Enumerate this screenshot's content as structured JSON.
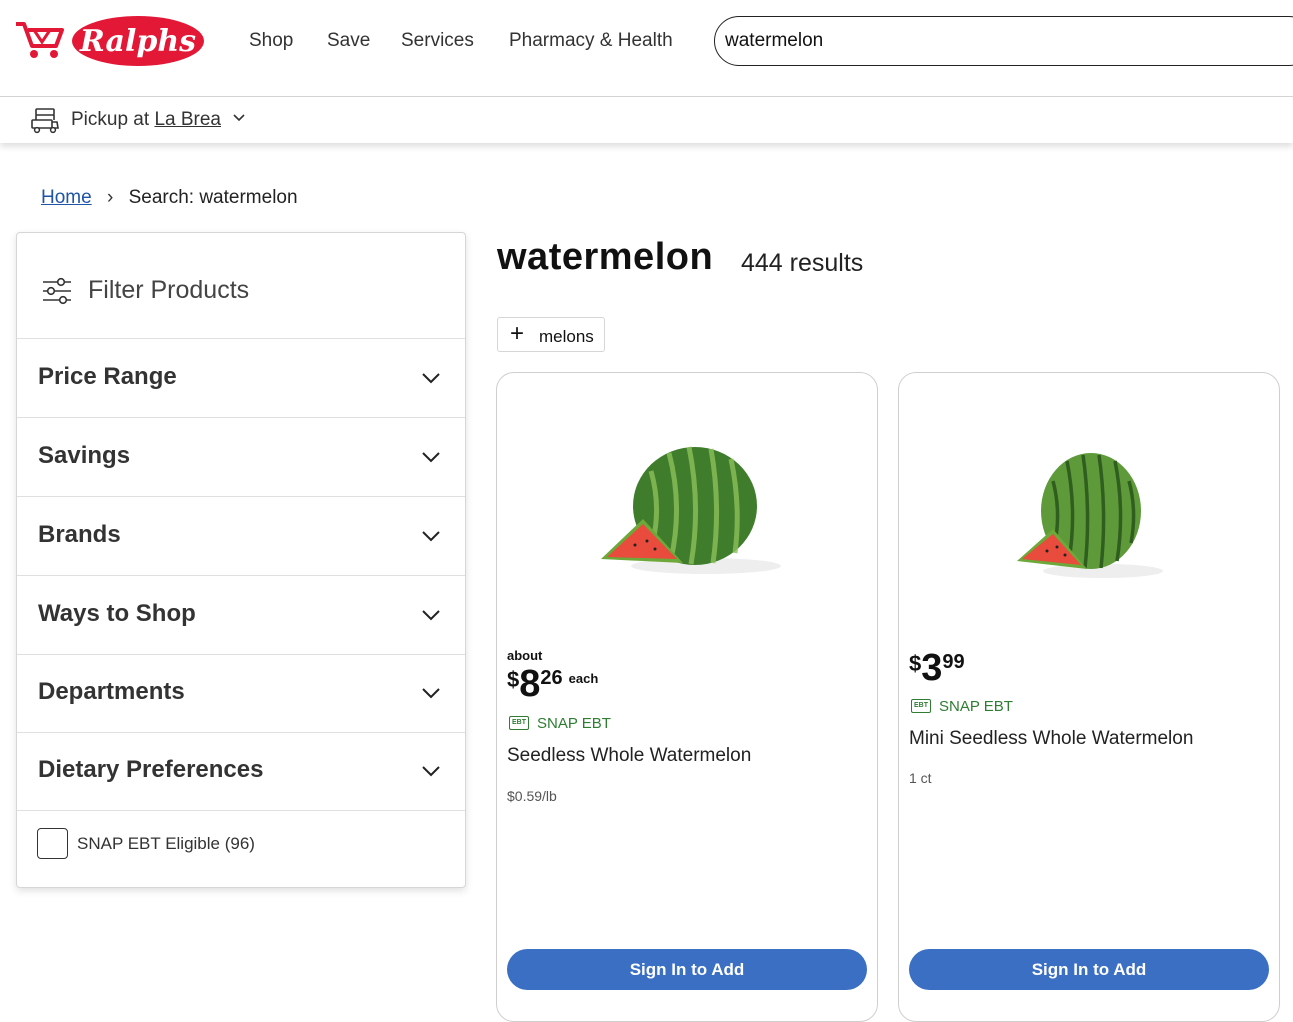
{
  "brand": {
    "logo_text": "Ralphs",
    "primary_color": "#e31837",
    "accent_color": "#3a6fc4"
  },
  "nav": {
    "items": [
      "Shop",
      "Save",
      "Services",
      "Pharmacy & Health"
    ]
  },
  "search": {
    "value": "watermelon"
  },
  "pickup": {
    "prefix": "Pickup at",
    "location": "La Brea"
  },
  "breadcrumb": {
    "home": "Home",
    "separator": "›",
    "current": "Search: watermelon"
  },
  "filters": {
    "title": "Filter Products",
    "facets": [
      "Price Range",
      "Savings",
      "Brands",
      "Ways to Shop",
      "Departments",
      "Dietary Preferences"
    ],
    "snap_checkbox": {
      "label": "SNAP EBT Eligible (96)",
      "checked": false
    }
  },
  "results": {
    "query": "watermelon",
    "count": "444 results",
    "chip": "melons"
  },
  "products": [
    {
      "about": "about",
      "currency": "$",
      "dollars": "8",
      "cents": "26",
      "unit": "each",
      "snap": "SNAP EBT",
      "ebt_badge": "EBT",
      "name": "Seedless Whole Watermelon",
      "sub": "$0.59/lb",
      "button": "Sign In to Add"
    },
    {
      "currency": "$",
      "dollars": "3",
      "cents": "99",
      "snap": "SNAP EBT",
      "ebt_badge": "EBT",
      "name": "Mini Seedless Whole Watermelon",
      "sub": "1 ct",
      "button": "Sign In to Add"
    }
  ]
}
